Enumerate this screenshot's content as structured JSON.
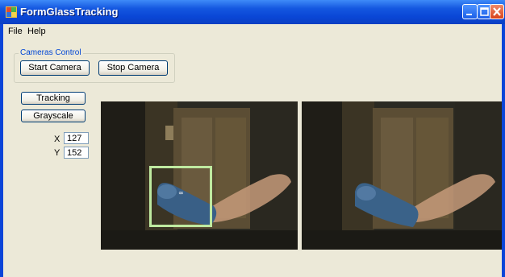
{
  "window": {
    "title": "FormGlassTracking",
    "controls": {
      "minimize": "_",
      "maximize": "□",
      "close": "X"
    },
    "colors": {
      "titlebar": "#0a46d6",
      "client": "#ece9d8",
      "close": "#d8431b"
    }
  },
  "menu": {
    "items": [
      "File",
      "Help"
    ]
  },
  "cameras_control": {
    "title": "Cameras Control",
    "start_label": "Start Camera",
    "stop_label": "Stop Camera"
  },
  "tracking_panel": {
    "tracking_label": "Tracking",
    "grayscale_label": "Grayscale",
    "x_label": "X",
    "x_value": "127",
    "y_label": "Y",
    "y_value": "152"
  },
  "views": {
    "tracked_view": {
      "marker": "∞"
    },
    "raw_view": {}
  },
  "icons": [
    "app-icon",
    "minimize-icon",
    "maximize-icon",
    "close-icon"
  ]
}
